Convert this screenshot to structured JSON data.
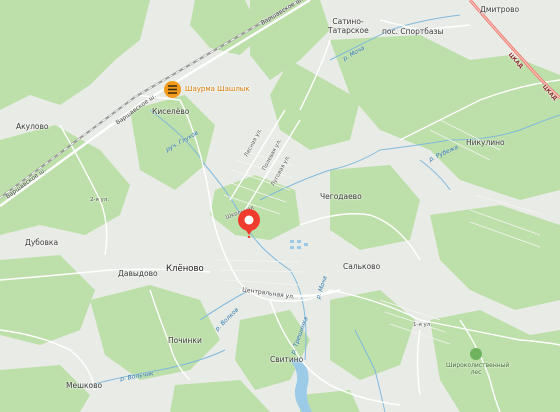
{
  "map": {
    "colors": {
      "land": "#e9ece6",
      "forest": "#bddfa9",
      "water": "#9ccbe8",
      "road": "#ffffff",
      "railway": "#8d8d8d",
      "highway": "#ef7e73",
      "marker": "#f03c2e",
      "poi": "#f29a1c"
    },
    "settlements": {
      "satino": "Сатино-Татарское",
      "sportbazy": "пос. Спортбазы",
      "dmitrovo": "Дмитрово",
      "akulovo": "Акулово",
      "kiselevo": "Киселёво",
      "nikulino": "Никулино",
      "chegodaevo": "Чегодаево",
      "dubovka": "Дубовка",
      "dyavidovo": "Давыдово",
      "klenovo": "Клёново",
      "salkovo": "Сальково",
      "pochinki": "Починки",
      "svitino": "Свитино",
      "meshkovo": "Мешково",
      "shiroko": "Широколиственный лес"
    },
    "roads": {
      "varshavskoe_top": "Варшавское ш.",
      "varshavskoe_mid": "Варшавское ш.",
      "varshavskoe_left": "Варшавское ш.",
      "tsentralnaya": "Центральная ул.",
      "lesnaya": "Лесная ул.",
      "polevaya": "Полевая ул.",
      "lugovaya": "Луговая ул.",
      "shkolnaya": "Школьная",
      "street_a": "2-я ул.",
      "street_b": "1-я ул."
    },
    "rivers": {
      "mocha_top": "р. Моча",
      "mocha_mid": "р. Моча",
      "ruchey": "руч. Глухов",
      "rubezh": "р. Рубежа",
      "volkov": "р. Волков",
      "volchik": "р. Вольчик",
      "trebushinka": "р. Трешинка"
    },
    "highway": {
      "tskad_top": "ЦКАД",
      "tskad_side": "ЦКАД"
    },
    "poi": {
      "name": "Шаурма Шашлык",
      "icon": "shawarma-grill-icon"
    },
    "marker": {
      "icon": "location-pin-icon"
    }
  }
}
